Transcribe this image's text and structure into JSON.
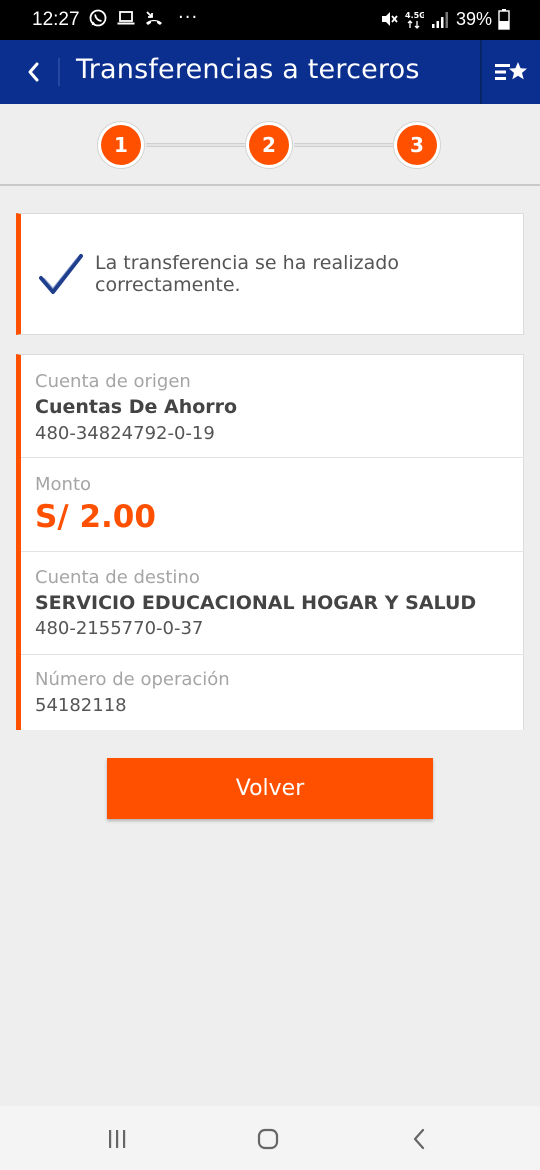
{
  "status_bar": {
    "time": "12:27",
    "battery": "39%",
    "overflow": "···",
    "icons_left": [
      "whatsapp-icon",
      "laptop-icon",
      "missed-call-icon"
    ],
    "icons_right": [
      "mute-icon",
      "signal-4g-icon",
      "signal-bars-icon",
      "battery-icon"
    ]
  },
  "header": {
    "title": "Transferencias a terceros",
    "back_icon": "chevron-left-icon",
    "favorites_icon": "list-star-icon"
  },
  "stepper": {
    "steps": [
      "1",
      "2",
      "3"
    ],
    "current": 3
  },
  "success": {
    "message": "La transferencia se ha realizado correctamente.",
    "icon": "checkmark-icon"
  },
  "details": {
    "origin": {
      "label": "Cuenta de origen",
      "name": "Cuentas De Ahorro",
      "number": "480-34824792-0-19"
    },
    "amount": {
      "label": "Monto",
      "value": "S/ 2.00"
    },
    "destination": {
      "label": "Cuenta de destino",
      "name": "SERVICIO EDUCACIONAL HOGAR Y SALUD",
      "number": "480-2155770-0-37"
    },
    "operation": {
      "label": "Número de operación",
      "value": "54182118"
    }
  },
  "actions": {
    "back_label": "Volver"
  },
  "nav_bar": {
    "icons": [
      "recent-apps-icon",
      "home-icon",
      "back-icon"
    ]
  },
  "colors": {
    "header_blue": "#0b2f8f",
    "accent_orange": "#ff5000",
    "background": "#efeeee"
  }
}
